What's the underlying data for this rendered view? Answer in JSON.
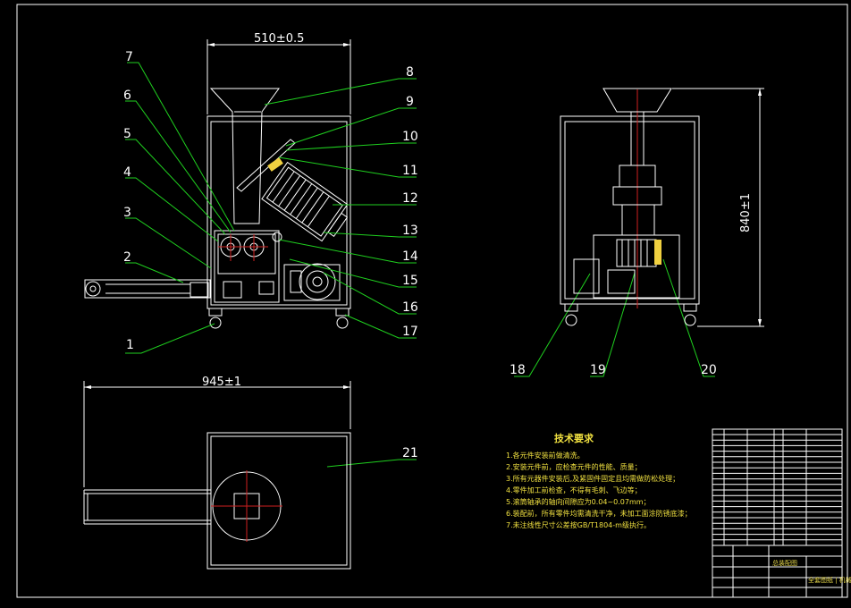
{
  "dimensions": {
    "front_width": "510±0.5",
    "top_length": "945±1",
    "side_height": "840±1"
  },
  "part_labels": [
    "1",
    "2",
    "3",
    "4",
    "5",
    "6",
    "7",
    "8",
    "9",
    "10",
    "11",
    "12",
    "13",
    "14",
    "15",
    "16",
    "17",
    "18",
    "19",
    "20",
    "21"
  ],
  "tech_requirements": {
    "title": "技术要求",
    "items": [
      "1.各元件安装前做清洗。",
      "2.安装元件前，应检查元件的性能、质量；",
      "3.所有元器件安装后,及紧固件固定且均需做防松处理；",
      "4.零件加工前检查，不得有毛刺、飞边等；",
      "5.滚筒轴承的轴向间隙应为0.04~0.07mm；",
      "6.装配前，所有零件均需清洗干净，未加工面涂防锈底漆；",
      "7.未注线性尺寸公差按GB/T1804-m级执行。"
    ]
  },
  "title_block": {
    "drawing_name": "总装配图",
    "subtitle": "全套图纸 | 机械设计"
  },
  "colors": {
    "line": "#ffffff",
    "leader": "#1fd01f",
    "center": "#d01f1f",
    "text_yellow": "#f0e040"
  }
}
